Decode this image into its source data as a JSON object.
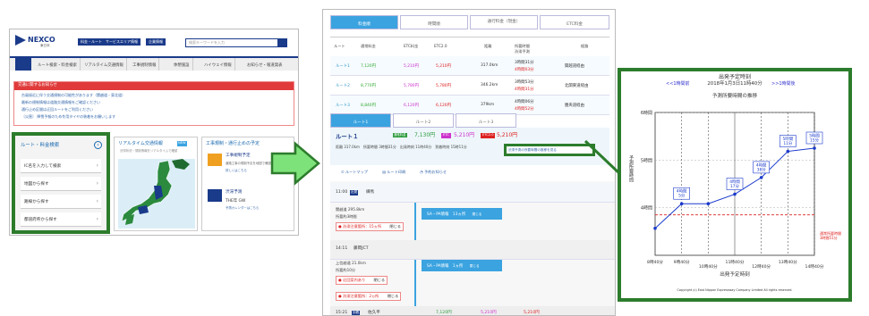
{
  "siteA": {
    "logo": "NEXCO",
    "logo_sub": "東日本",
    "nav_buttons": [
      "料金・ルート",
      "サービスエリア情報",
      "企業情報"
    ],
    "search_placeholder": "検索キーワードを入力",
    "nav": [
      "ルート検索・料金検索",
      "リアルタイム交通情報",
      "工事規制情報",
      "休憩施設",
      "ハイウェイ情報",
      "お知らせ・報道発表"
    ],
    "alert_title": "交通に関するお知らせ",
    "alert_lines": [
      "台風接近に伴う交通規制の可能性があります（関越道・東北道）",
      "最新の規制情報は道路交通情報をご確認ください",
      "通行止め区間は迂回ルートをご利用ください",
      "〔災害〕 降雪予報のため冬用タイヤの装着をお願いします"
    ],
    "route_title": "ルート・料金検索",
    "route_items": [
      "IC名を入力して検索",
      "地図から探す",
      "路線から探す",
      "都道府県から探す"
    ],
    "realtime_title": "リアルタイム交通情報",
    "realtime_badge": "NEW",
    "realtime_sub": "渋滞状況・規制情報をリアルタイムで確認",
    "kouji_title": "工事規制・通行止めの予定",
    "kouji1_title": "工事規制予定",
    "kouji1_sub": "道路工事の規制予定を地図で確認できます",
    "kouji1_link": "詳しくはこちら",
    "kouji2_title": "渋滞予測",
    "kouji2_sub": "THE年 GW",
    "kouji2_link": "予測カレンダーはこちら"
  },
  "siteB": {
    "tabs": [
      "料金順",
      "時間順",
      "通行料金（現金）",
      "ETC料金"
    ],
    "headers": [
      "ルート",
      "通常料金",
      "ETC料金",
      "ETC2.0",
      "距離",
      "所要時間",
      "渋滞予測",
      "経路"
    ],
    "rows": [
      {
        "route": "ルート1",
        "cash": "7,120円",
        "etc": "5,210円",
        "etc2": "5,210円",
        "dist": "317.0km",
        "time": "3時間31分",
        "jam": "4時間03分",
        "via": "関越道経由"
      },
      {
        "route": "ルート2",
        "cash": "8,770円",
        "etc": "5,780円",
        "etc2": "5,780円",
        "dist": "346.2km",
        "time": "3時間53分",
        "jam": "4時間31分",
        "via": "北関東道経由"
      },
      {
        "route": "ルート3",
        "cash": "8,840円",
        "etc": "6,120円",
        "etc2": "6,120円",
        "dist": "379km",
        "time": "4時間06分",
        "jam": "4時間52分",
        "via": "圏央道経由"
      }
    ],
    "route_tabs": [
      "ルート1",
      "ルート2",
      "ルート3"
    ],
    "sel_route": "ルート１",
    "sel_cash_label": "通常料金",
    "sel_cash": "7,130円",
    "sel_etc_label": "ETC",
    "sel_etc": "5,210円",
    "sel_etc2_label": "ETC2.0",
    "sel_etc2": "5,210円",
    "sel_meta": "距離 317.0km　所要時間 3時間31分　出発時刻 11時40分　到着時刻 15時11分",
    "jam_link": "渋滞予測の所要時間の推移を見る",
    "actions": [
      "ルートマップ",
      "ルート印刷",
      "予約お知らせ"
    ],
    "t1": "11:00",
    "t1b": "出発",
    "t1c": "練馬",
    "seg1": [
      "関越道 295.8km",
      "所要約3時間"
    ],
    "sa1": "SA・PA情報　13ヵ所",
    "sa1b": "閉じる",
    "warn1": "渋滞注意箇所：15ヵ所",
    "warn1b": "閉じる",
    "t2": "14:11",
    "t2b": "藤岡JCT",
    "seg2": [
      "上信越道 21.0km",
      "所要約10分"
    ],
    "sa2": "SA・PA情報　1ヵ所",
    "sa2b": "閉じる",
    "warn2": "迂回案内あり",
    "warn2b": "閉じる",
    "warn3": "渋滞注意箇所：2ヵ所",
    "warn3b": "閉じる",
    "t3": "15:21",
    "t3b": "到着",
    "t3c": "佐久平",
    "btm_cash": "7,120円",
    "btm_etc": "5,210円",
    "btm_etc2": "5,210円"
  },
  "siteC": {
    "title": "出発予定時刻",
    "date": "2018年1月3日11時40分",
    "prev": "<<1時間前",
    "next": ">>1時間後",
    "chart_title": "予測所要時間の推移",
    "ylabel": "予測所要時間",
    "xlabel": "出発予定時刻",
    "legend": [
      "通常所要時間",
      "3時間51分"
    ],
    "copyright": "Copyright (c) East Nippon Expressway Company Limited All rights reserved."
  },
  "chart_data": {
    "type": "line",
    "title": "予測所要時間の推移",
    "xlabel": "出発予定時刻",
    "ylabel": "予測所要時間",
    "xticks": [
      "9時40分",
      "10時40分",
      "11時40分",
      "12時40分",
      "13時40分",
      "14時40分"
    ],
    "yticks": [
      "6時間",
      "5時間",
      "4時間"
    ],
    "points": [
      {
        "x": "8時40分",
        "y": "",
        "label": ""
      },
      {
        "x": "9時40分",
        "y": "4時間05分",
        "label": "4時間\n5分"
      },
      {
        "x": "10時40分",
        "y": "4時間05分",
        "label": ""
      },
      {
        "x": "11時40分",
        "y": "4時間17分",
        "label": "4時間\n17分"
      },
      {
        "x": "12時40分",
        "y": "4時間38分",
        "label": "4時間\n38分"
      },
      {
        "x": "13時40分",
        "y": "5時間11分",
        "label": "5時間\n11分"
      },
      {
        "x": "14時40分",
        "y": "5時間15分",
        "label": "5時間\n15分"
      }
    ],
    "reference": {
      "label": "通常所要時間 3時間51分",
      "color": "#d22"
    }
  },
  "colors": {
    "green": "#2c7c2c",
    "blue": "#1a3a8a",
    "accent": "#3ba3e0",
    "red": "#d22"
  }
}
